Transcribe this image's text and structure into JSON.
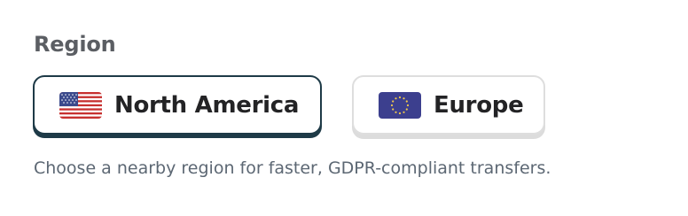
{
  "region": {
    "heading": "Region",
    "options": [
      {
        "label": "North America",
        "flag": "us-flag-icon",
        "selected": true
      },
      {
        "label": "Europe",
        "flag": "eu-flag-icon",
        "selected": false
      }
    ],
    "helper_text": "Choose a nearby region for faster, GDPR-compliant transfers."
  },
  "colors": {
    "selected_border": "#1e3a47",
    "unselected_border": "#dedede",
    "heading_text": "#5b5e63",
    "label_text": "#232325",
    "helper_text": "#5c6773"
  }
}
